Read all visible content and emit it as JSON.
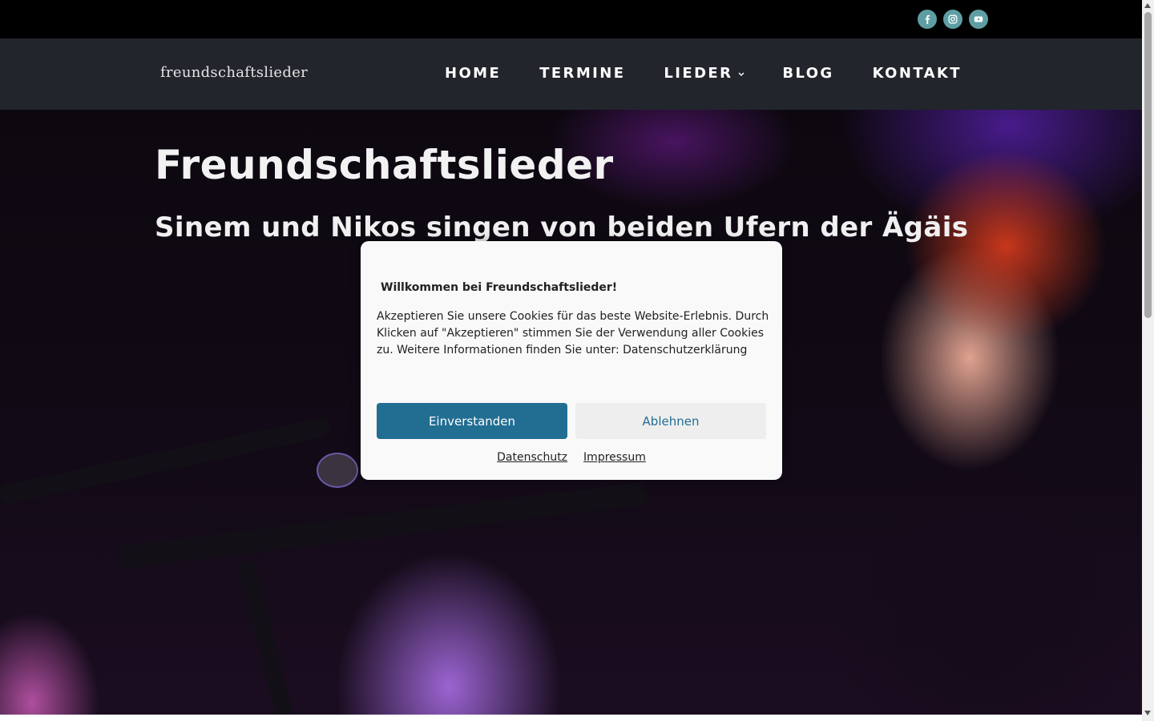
{
  "social": {
    "items": [
      {
        "name": "facebook-icon"
      },
      {
        "name": "instagram-icon"
      },
      {
        "name": "youtube-icon"
      }
    ],
    "color": "#5e9ea3"
  },
  "header": {
    "logo": "freundschaftslieder",
    "nav": {
      "home": "HOME",
      "termine": "TERMINE",
      "lieder": "LIEDER",
      "blog": "BLOG",
      "kontakt": "KONTAKT"
    },
    "background": "#22252c"
  },
  "hero": {
    "title": "Freundschaftslieder",
    "subtitle": "Sinem und Nikos singen von beiden Ufern der Ägäis"
  },
  "cookie": {
    "title": "Willkommen bei Freundschaftslieder!",
    "text": "Akzeptieren Sie unsere Cookies für das beste Website-Erlebnis. Durch Klicken auf \"Akzeptieren\" stimmen Sie der Verwendung aller Cookies zu. Weitere Informationen finden Sie unter: Datenschutzerklärung",
    "accept_label": "Einverstanden",
    "deny_label": "Ablehnen",
    "link_privacy": "Datenschutz",
    "link_imprint": "Impressum",
    "accent": "#226e93"
  }
}
